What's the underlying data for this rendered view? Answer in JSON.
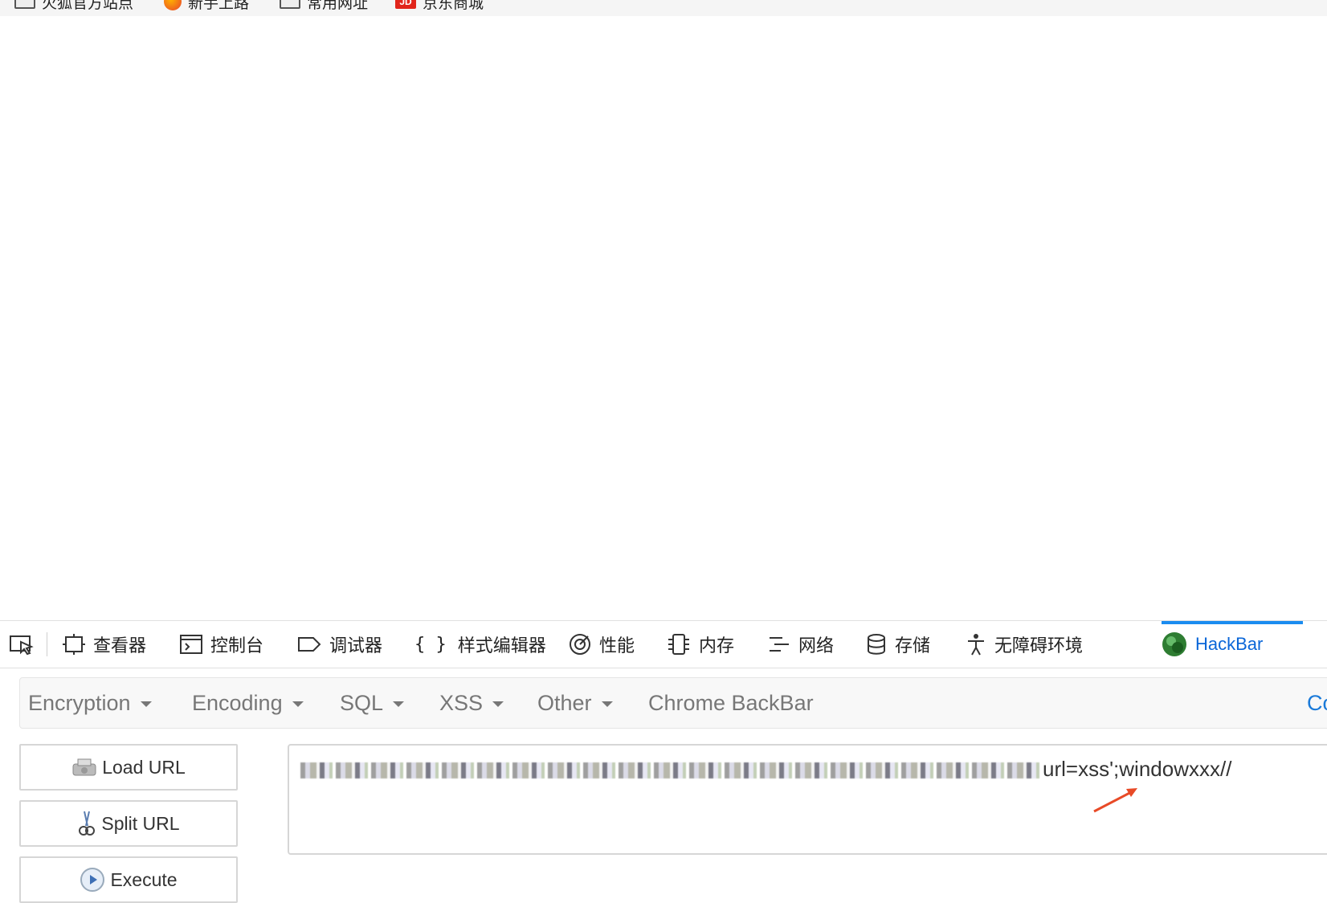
{
  "bookmarks": [
    {
      "label": "火狐官方站点",
      "icon": "folder-icon"
    },
    {
      "label": "新手上路",
      "icon": "firefox-icon"
    },
    {
      "label": "常用网址",
      "icon": "folder-icon"
    },
    {
      "label": "京东商城",
      "icon": "jd-icon",
      "icon_text": "JD"
    }
  ],
  "devtools": {
    "tabs": [
      {
        "label": "查看器",
        "icon": "inspector-icon"
      },
      {
        "label": "控制台",
        "icon": "console-icon"
      },
      {
        "label": "调试器",
        "icon": "debugger-icon"
      },
      {
        "label": "样式编辑器",
        "icon": "style-editor-icon",
        "icon_text": "{ }"
      },
      {
        "label": "性能",
        "icon": "performance-icon"
      },
      {
        "label": "内存",
        "icon": "memory-icon"
      },
      {
        "label": "网络",
        "icon": "network-icon"
      },
      {
        "label": "存储",
        "icon": "storage-icon"
      },
      {
        "label": "无障碍环境",
        "icon": "accessibility-icon"
      },
      {
        "label": "HackBar",
        "icon": "hackbar-icon",
        "active": true
      }
    ],
    "accent_color": "#1a8cf0"
  },
  "hackbar": {
    "menu": [
      {
        "label": "Encryption",
        "dropdown": true
      },
      {
        "label": "Encoding",
        "dropdown": true
      },
      {
        "label": "SQL",
        "dropdown": true
      },
      {
        "label": "XSS",
        "dropdown": true
      },
      {
        "label": "Other",
        "dropdown": true
      },
      {
        "label": "Chrome BackBar",
        "dropdown": false
      }
    ],
    "menu_cutoff_label": "Co",
    "buttons": {
      "load_url": "Load URL",
      "split_url": "Split URL",
      "execute": "Execute"
    },
    "url_value_visible": "url=xss';windowxxx//"
  }
}
